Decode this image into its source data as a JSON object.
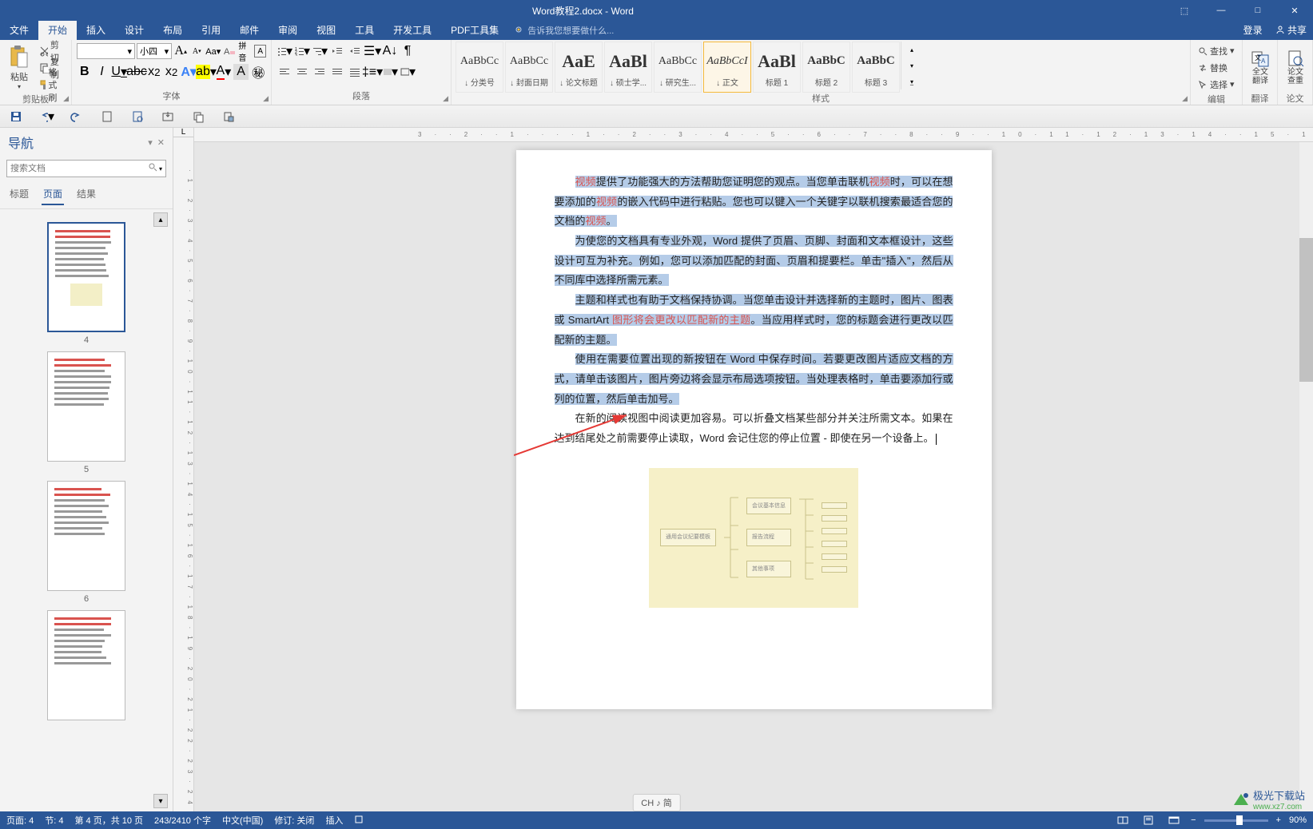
{
  "window": {
    "title": "Word教程2.docx - Word",
    "ribbon_display": "⬚",
    "minimize": "—",
    "maximize": "□",
    "close": "✕"
  },
  "menu": {
    "items": [
      "文件",
      "开始",
      "插入",
      "设计",
      "布局",
      "引用",
      "邮件",
      "审阅",
      "视图",
      "工具",
      "开发工具",
      "PDF工具集"
    ],
    "active": "开始",
    "tellme_placeholder": "告诉我您想要做什么...",
    "login": "登录",
    "share": "共享"
  },
  "ribbon": {
    "clipboard": {
      "label": "剪贴板",
      "paste": "粘贴",
      "cut": "剪切",
      "copy": "复制",
      "format_painter": "格式刷"
    },
    "font": {
      "label": "字体",
      "name": "",
      "size": "小四",
      "bold": "B",
      "italic": "I",
      "underline": "U"
    },
    "paragraph": {
      "label": "段落"
    },
    "styles": {
      "label": "样式",
      "items": [
        {
          "preview": "AaBbCc",
          "name": "↓ 分类号"
        },
        {
          "preview": "AaBbCc",
          "name": "↓ 封面日期"
        },
        {
          "preview": "AaE",
          "name": "↓ 论文标题"
        },
        {
          "preview": "AaBl",
          "name": "↓ 硕士学..."
        },
        {
          "preview": "AaBbCc",
          "name": "↓ 研究生..."
        },
        {
          "preview": "AaBbCcI",
          "name": "↓ 正文"
        },
        {
          "preview": "AaBl",
          "name": "标题 1"
        },
        {
          "preview": "AaBbC",
          "name": "标题 2"
        },
        {
          "preview": "AaBbC",
          "name": "标题 3"
        }
      ],
      "selected": 5
    },
    "editing": {
      "label": "编辑",
      "find": "查找",
      "replace": "替换",
      "select": "选择"
    },
    "translate": {
      "label": "翻译",
      "btn": "全文翻译"
    },
    "paper": {
      "label": "论文",
      "btn": "论文查重"
    }
  },
  "nav": {
    "title": "导航",
    "search_placeholder": "搜索文档",
    "tabs": [
      "标题",
      "页面",
      "结果"
    ],
    "active_tab": "页面",
    "thumbnails": [
      {
        "num": "4",
        "selected": true,
        "has_img": true
      },
      {
        "num": "5",
        "selected": false,
        "has_img": false
      },
      {
        "num": "6",
        "selected": false,
        "has_img": false
      },
      {
        "num": "",
        "selected": false,
        "has_img": false
      }
    ]
  },
  "ruler": {
    "h": "3··2··1····1··2··3··4··5··6··7··8··9··10·11·12·13·14··15·16·17·",
    "v": "·1·2·3·4·5·6·7·8·9·10·11·12·13·14·15·16·17·18·19·20·21·22·23·24·",
    "corner": "L"
  },
  "document": {
    "p1_a": "视频",
    "p1_b": "提供了功能强大的方法帮助您证明您的观点。当您单击联机",
    "p1_c": "视频",
    "p1_d": "时，可以在想要添加的",
    "p1_e": "视频",
    "p1_f": "的嵌入代码中进行粘贴。您也可以键入一个关键字以联机搜索最适合您的文档的",
    "p1_g": "视频",
    "p1_h": "。",
    "p2": "为使您的文档具有专业外观，Word 提供了页眉、页脚、封面和文本框设计，这些设计可互为补充。例如，您可以添加匹配的封面、页眉和提要栏。单击\"插入\"，然后从不同库中选择所需元素。",
    "p3_a": "主题和样式也有助于文档保持协调。当您单击设计并选择新的主题时，图片、图表或 SmartArt ",
    "p3_b": "图形将会更改以匹配新的主题",
    "p3_c": "。当应用样式时，您的标题会进行更改以匹配新的主题。",
    "p4": "使用在需要位置出现的新按钮在 Word 中保存时间。若要更改图片适应文档的方式，请单击该图片，图片旁边将会显示布局选项按钮。当处理表格时，单击要添加行或列的位置，然后单击加号。",
    "p5": "在新的阅读视图中阅读更加容易。可以折叠文档某些部分并关注所需文本。如果在达到结尾处之前需要停止读取，Word 会记住您的停止位置 - 即使在另一个设备上。",
    "diagram_center": "通用会议纪要模板",
    "diagram_top": "会议基本信息",
    "diagram_mid": "报告流程",
    "diagram_bot": "其他事项"
  },
  "status": {
    "page": "页面: 4",
    "section": "节: 4",
    "page_of": "第 4 页，共 10 页",
    "words": "243/2410 个字",
    "lang": "中文(中国)",
    "revise": "修订: 关闭",
    "insert": "插入",
    "zoom": "90%"
  },
  "lang_indicator": "CH ♪ 简",
  "watermark": {
    "name": "极光下载站",
    "url": "www.xz7.com"
  }
}
